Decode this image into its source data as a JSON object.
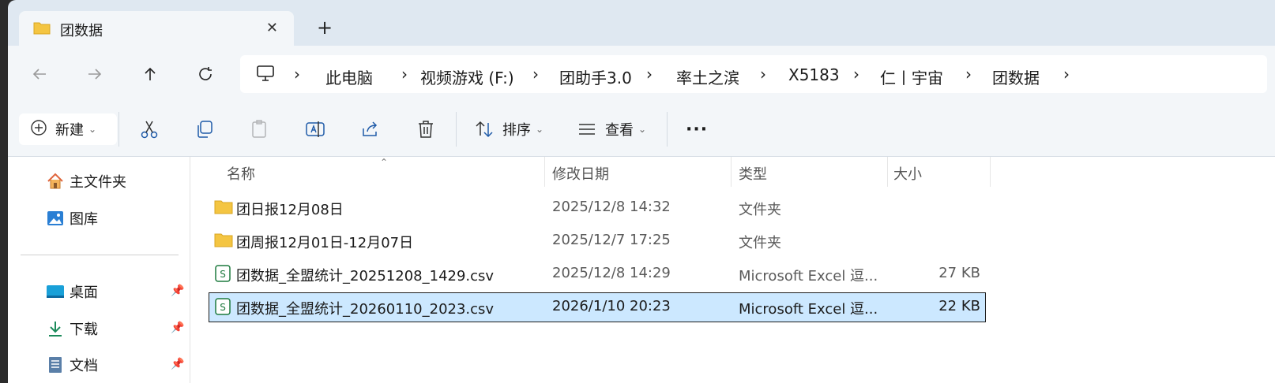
{
  "tab": {
    "title": "团数据",
    "new_tab_label": "+"
  },
  "nav": {
    "back": "←",
    "forward": "→",
    "up": "↑",
    "refresh": "⟳"
  },
  "breadcrumb": {
    "items": [
      "此电脑",
      "视频游戏 (F:)",
      "团助手3.0",
      "率土之滨",
      "X5183",
      "仁丨宇宙",
      "团数据"
    ],
    "separator": "›"
  },
  "toolbar": {
    "new_label": "新建",
    "sort_label": "排序",
    "view_label": "查看",
    "more_label": "···"
  },
  "sidebar": {
    "items": [
      {
        "label": "主文件夹",
        "icon": "home-icon",
        "pinned": false
      },
      {
        "label": "图库",
        "icon": "gallery-icon",
        "pinned": false
      },
      {
        "label": "桌面",
        "icon": "desktop-icon",
        "pinned": true
      },
      {
        "label": "下载",
        "icon": "download-icon",
        "pinned": true
      },
      {
        "label": "文档",
        "icon": "document-icon",
        "pinned": true
      }
    ]
  },
  "columns": {
    "name": "名称",
    "date": "修改日期",
    "type": "类型",
    "size": "大小"
  },
  "files": [
    {
      "name": "团日报12月08日",
      "date": "2025/12/8 14:32",
      "type": "文件夹",
      "size": "",
      "icon": "folder-icon",
      "selected": false
    },
    {
      "name": "团周报12月01日-12月07日",
      "date": "2025/12/7 17:25",
      "type": "文件夹",
      "size": "",
      "icon": "folder-icon",
      "selected": false
    },
    {
      "name": "团数据_全盟统计_20251208_1429.csv",
      "date": "2025/12/8 14:29",
      "type": "Microsoft Excel 逗...",
      "size": "27 KB",
      "icon": "csv-icon",
      "selected": false
    },
    {
      "name": "团数据_全盟统计_20260110_2023.csv",
      "date": "2026/1/10 20:23",
      "type": "Microsoft Excel 逗...",
      "size": "22 KB",
      "icon": "csv-icon",
      "selected": true
    }
  ],
  "colors": {
    "accent_folder": "#f4c542",
    "selection": "#cce8ff",
    "csv_green": "#1d7a3e"
  }
}
